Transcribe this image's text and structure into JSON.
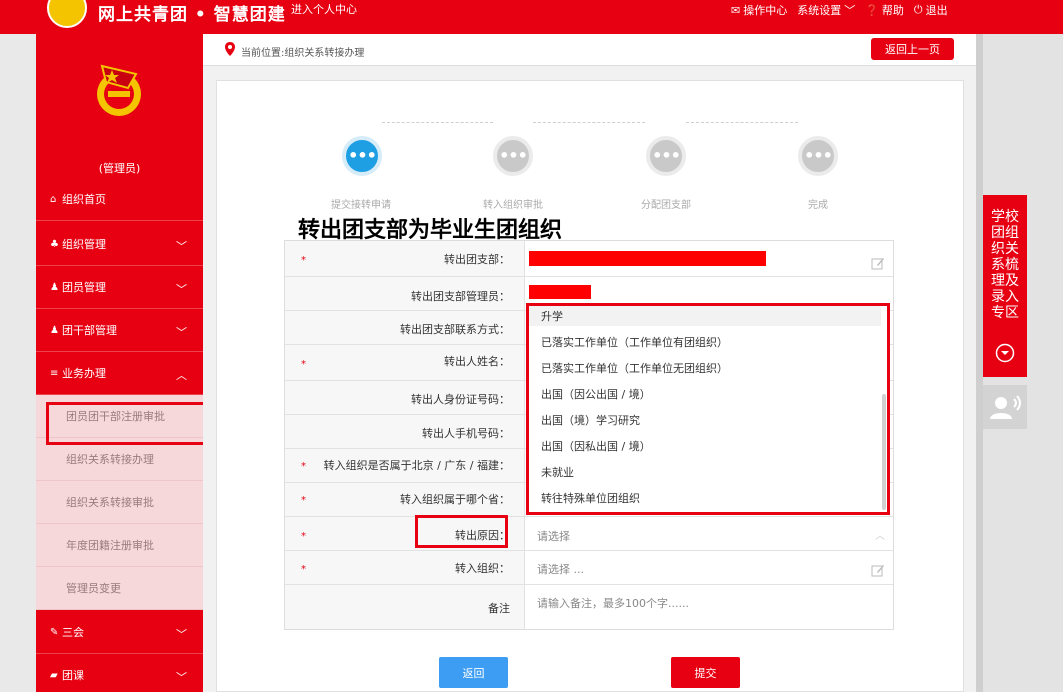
{
  "header": {
    "brand": "网上共青团 • 智慧团建",
    "personal_center": "进入个人中心",
    "menu": {
      "ops_center": "操作中心",
      "settings": "系统设置",
      "help": "帮助",
      "logout": "退出"
    }
  },
  "sidebar": {
    "role": "(管理员)",
    "items": {
      "home": "组织首页",
      "org_mgmt": "组织管理",
      "member_mgmt": "团员管理",
      "cadre_mgmt": "团干部管理",
      "business": "业务办理",
      "sanhui": "三会",
      "tuanke": "团课"
    },
    "sub_items": {
      "reg_review": "团员团干部注册审批",
      "transfer": "组织关系转接办理",
      "transfer_review": "组织关系转接审批",
      "annual_review": "年度团籍注册审批",
      "admin_change": "管理员变更"
    }
  },
  "breadcrumb": {
    "text": "当前位置:组织关系转接办理",
    "back_button": "返回上一页"
  },
  "steps": {
    "s1": "提交接转申请",
    "s2": "转入组织审批",
    "s3": "分配团支部",
    "s4": "完成",
    "dots": "•••"
  },
  "section_title": "转出团支部为毕业生团组织",
  "form": {
    "out_branch": "转出团支部：",
    "out_admin": "转出团支部管理员：",
    "out_contact": "转出团支部联系方式：",
    "name": "转出人姓名：",
    "id_no": "转出人身份证号码：",
    "phone": "转出人手机号码：",
    "region_q": "转入组织是否属于北京 / 广东 / 福建：",
    "province_q": "转入组织属于哪个省：",
    "reason": "转出原因：",
    "reason_placeholder": "请选择",
    "target_org": "转入组织：",
    "target_placeholder": "请选择 ...",
    "remark": "备注",
    "remark_placeholder": "请输入备注，最多100个字......",
    "star": "*"
  },
  "dropdown": {
    "options": [
      "升学",
      "已落实工作单位（工作单位有团组织）",
      "已落实工作单位（工作单位无团组织）",
      "出国（因公出国 / 境）",
      "出国（境）学习研究",
      "出国（因私出国 / 境）",
      "未就业",
      "转往特殊单位团组织"
    ]
  },
  "buttons": {
    "back": "返回",
    "submit": "提交"
  },
  "side_panel": {
    "tab_text": "学校团组织关系梳理及录入专区"
  },
  "colors": {
    "brand_red": "#e60012",
    "active_blue": "#1e9fe3",
    "back_blue": "#3d9df2"
  }
}
